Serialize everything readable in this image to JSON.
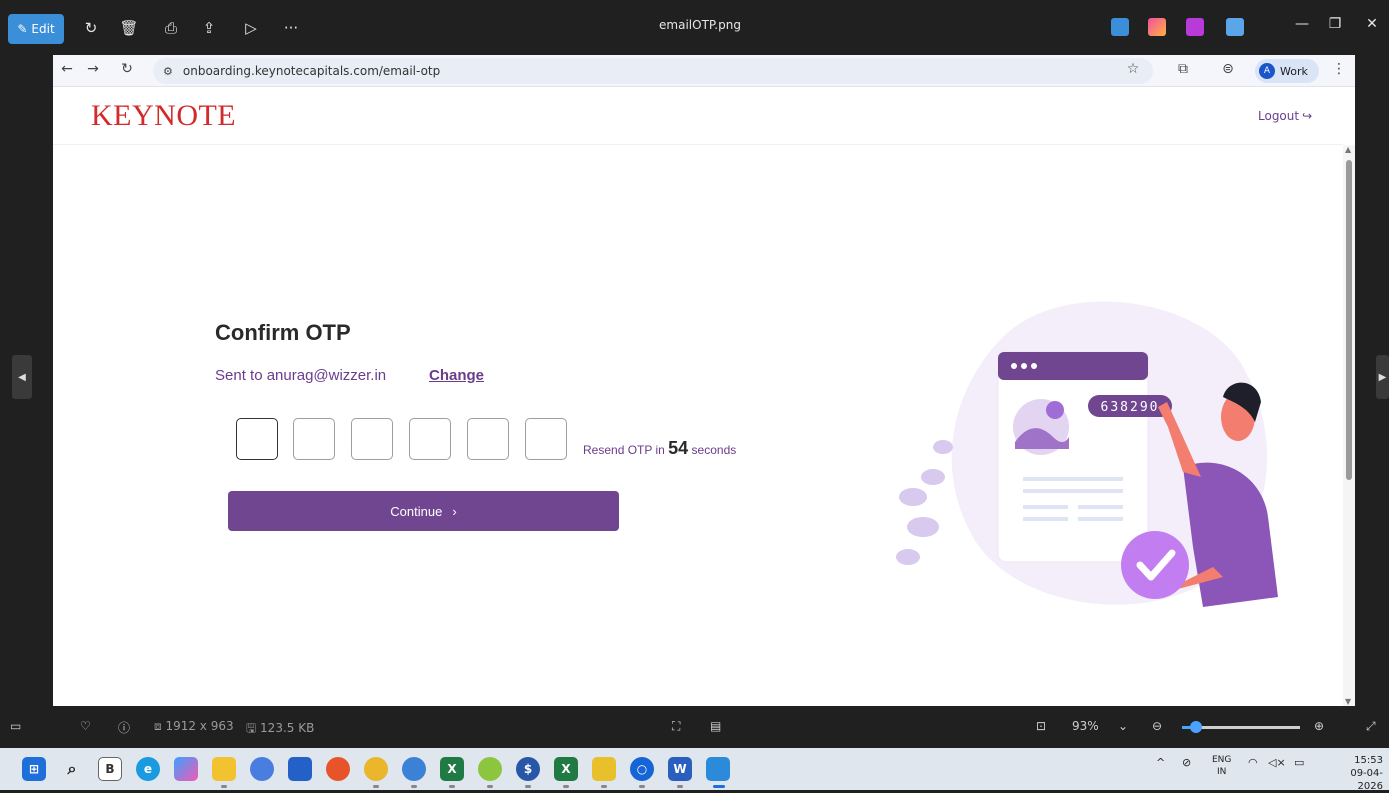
{
  "viewer": {
    "edit_label": "Edit",
    "file_title": "emailOTP.png",
    "image_info": "1912 x 963",
    "file_size": "123.5 KB",
    "zoom": "93%",
    "zoom_fraction": 0.12
  },
  "browser": {
    "url": "onboarding.keynotecapitals.com/email-otp",
    "profile_initial": "A",
    "profile_label": "Work"
  },
  "site": {
    "logo": "KEYNOTE",
    "logout": "Logout"
  },
  "otp": {
    "title": "Confirm OTP",
    "sent_prefix": "Sent to anurag@wizzer.in",
    "change": "Change",
    "resend_prefix": "Resend OTP in",
    "seconds": "54",
    "resend_suffix": "seconds",
    "continue": "Continue",
    "box_count": 6
  },
  "illustration": {
    "code": "638290"
  },
  "taskbar": {
    "lang_top": "ENG",
    "lang_bottom": "IN",
    "time": "15:53",
    "date": "09-04-2026"
  },
  "colors": {
    "brand_purple": "#704691",
    "logo_red": "#d12b2b"
  }
}
